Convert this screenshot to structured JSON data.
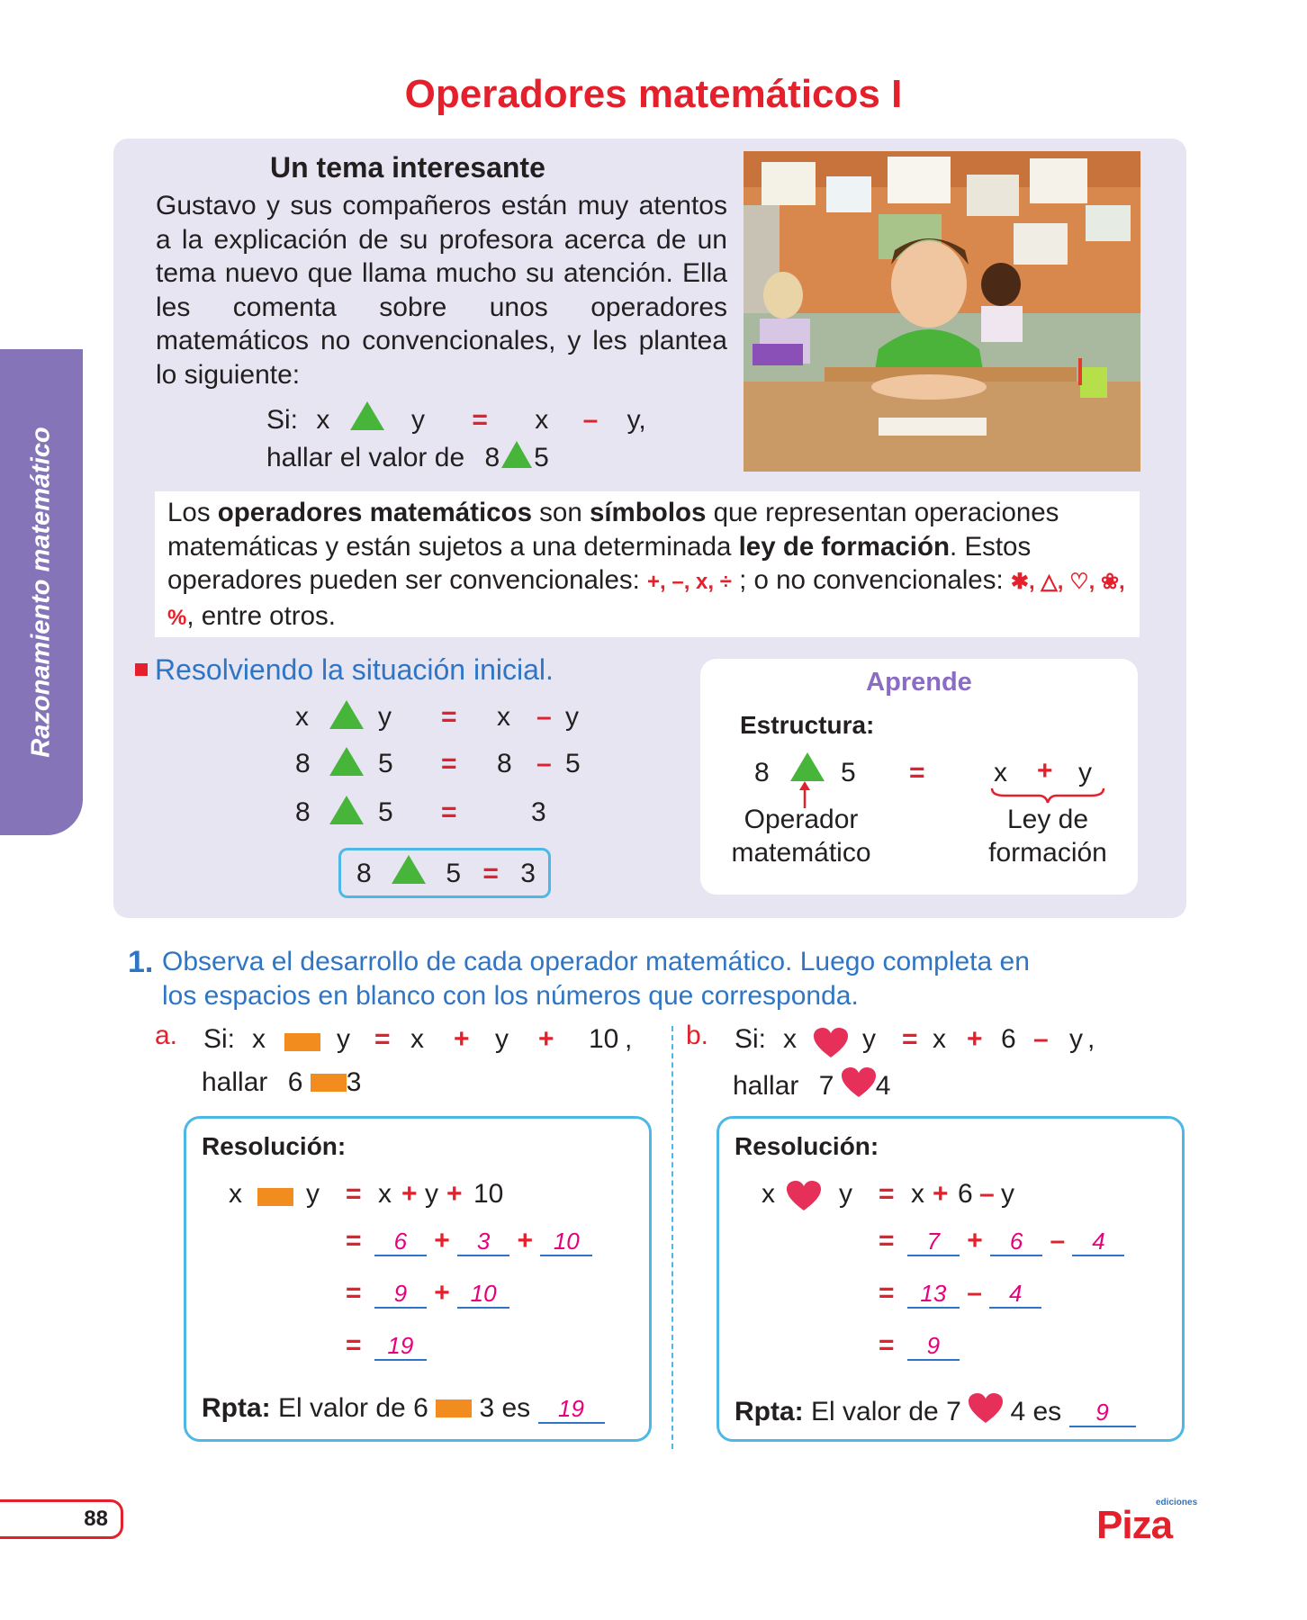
{
  "title": "Operadores matemáticos I",
  "side_tab": "Razonamiento matemático",
  "intro": {
    "heading": "Un tema interesante",
    "paragraph": "Gustavo y sus compañeros están muy atentos a la explicación de su profesora acerca de un tema nuevo que llama mucho su atención. Ella les comenta sobre unos operadores matemáticos no convencionales, y les plantea lo siguiente:",
    "si_label": "Si:",
    "x": "x",
    "y": "y",
    "eq": "=",
    "minus": "–",
    "comma": ",",
    "hallar": "hallar el valor de",
    "n8": "8",
    "n5": "5"
  },
  "definition": {
    "t1": "Los ",
    "b1": "operadores matemáticos",
    "t2": " son ",
    "b2": "símbolos",
    "t3": " que representan operaciones matemáticas y están sujetos a una determinada ",
    "b3": "ley de formación",
    "t4": ". Estos operadores pueden ser convencionales: ",
    "conv": "+, –, x, ÷",
    "t5": " ; o no convencionales: ",
    "nonconv": "✱, △, ♡, ❀, %",
    "t6": ", entre otros."
  },
  "resolving": {
    "heading": "Resolviendo la situación inicial.",
    "rows": [
      {
        "a": "x",
        "b": "y",
        "c": "x",
        "op": "–",
        "d": "y"
      },
      {
        "a": "8",
        "b": "5",
        "c": "8",
        "op": "–",
        "d": "5"
      },
      {
        "a": "8",
        "b": "5",
        "c": "3",
        "op": "",
        "d": ""
      }
    ],
    "result": {
      "a": "8",
      "b": "5",
      "c": "3"
    }
  },
  "aprende": {
    "heading": "Aprende",
    "estructura": "Estructura:",
    "a": "8",
    "b": "5",
    "x": "x",
    "plus": "+",
    "y": "y",
    "operador1": "Operador",
    "operador2": "matemático",
    "ley1": "Ley de",
    "ley2": "formación"
  },
  "question": {
    "number": "1.",
    "text1": "Observa el desarrollo de cada operador matemático. Luego completa en",
    "text2": "los espacios en blanco con los números que corresponda."
  },
  "part_a": {
    "letter": "a.",
    "si": "Si:",
    "def": [
      "x",
      "y",
      "=",
      "x",
      "+",
      "y",
      "+",
      "10",
      ","
    ],
    "hallar": "hallar",
    "h1": "6",
    "h2": "3",
    "resolucion": "Resolución:",
    "line0": [
      "x",
      "y",
      "=",
      "x",
      "+",
      "y",
      "+",
      "10"
    ],
    "line1": [
      "6",
      "3",
      "10"
    ],
    "line2": [
      "9",
      "10"
    ],
    "line3": [
      "19"
    ],
    "rpta_label": "Rpta:",
    "rpta_text": "El valor de 6",
    "rpta_text2": "3 es",
    "rpta_value": "19"
  },
  "part_b": {
    "letter": "b.",
    "si": "Si:",
    "def": [
      "x",
      "y",
      "=",
      "x",
      "+",
      "6",
      "–",
      "y",
      ","
    ],
    "hallar": "hallar",
    "h1": "7",
    "h2": "4",
    "resolucion": "Resolución:",
    "line0": [
      "x",
      "y",
      "=",
      "x",
      "+",
      "6",
      "–",
      "y"
    ],
    "line1": [
      "7",
      "6",
      "4"
    ],
    "line2": [
      "13",
      "4"
    ],
    "line3": [
      "9"
    ],
    "rpta_label": "Rpta:",
    "rpta_text": "El valor de 7",
    "rpta_text2": "4 es",
    "rpta_value": "9"
  },
  "page_number": "88",
  "logo": {
    "small": "ediciones",
    "main": "Piza"
  },
  "colors": {
    "title": "#e3202b",
    "panel": "#e8e5f3",
    "side_tab": "#8574b8",
    "accent_blue": "#2e75c5",
    "box_border": "#4db8e5",
    "triangle": "#47b53a",
    "rect": "#f28c1e",
    "heart": "#e6305a",
    "answer": "#e6007e"
  }
}
